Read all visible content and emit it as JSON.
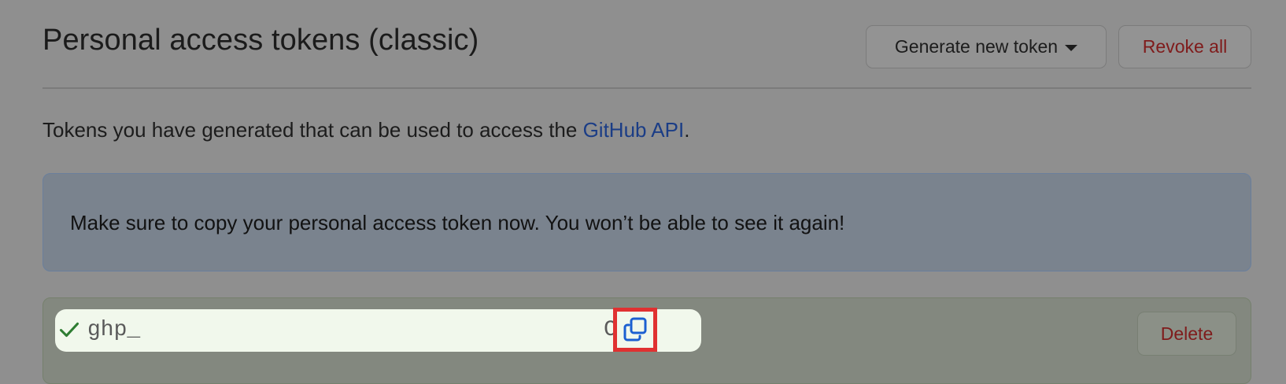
{
  "header": {
    "title": "Personal access tokens (classic)",
    "generate_button_label": "Generate new token",
    "revoke_all_label": "Revoke all"
  },
  "description": {
    "text_before_link": "Tokens you have generated that can be used to access the ",
    "link_text": "GitHub API",
    "text_after_link": "."
  },
  "flash": {
    "message": "Make sure to copy your personal access token now. You won’t be able to see it again!"
  },
  "token": {
    "prefix": "ghp_",
    "tail": "C",
    "delete_label": "Delete",
    "copy_icon": "copy-icon",
    "status_icon": "check-icon"
  },
  "colors": {
    "danger": "#7f1b1b",
    "link": "#1b3d86",
    "success": "#2e7d32",
    "copy_icon": "#1b5fd1",
    "highlight": "#e03131"
  }
}
